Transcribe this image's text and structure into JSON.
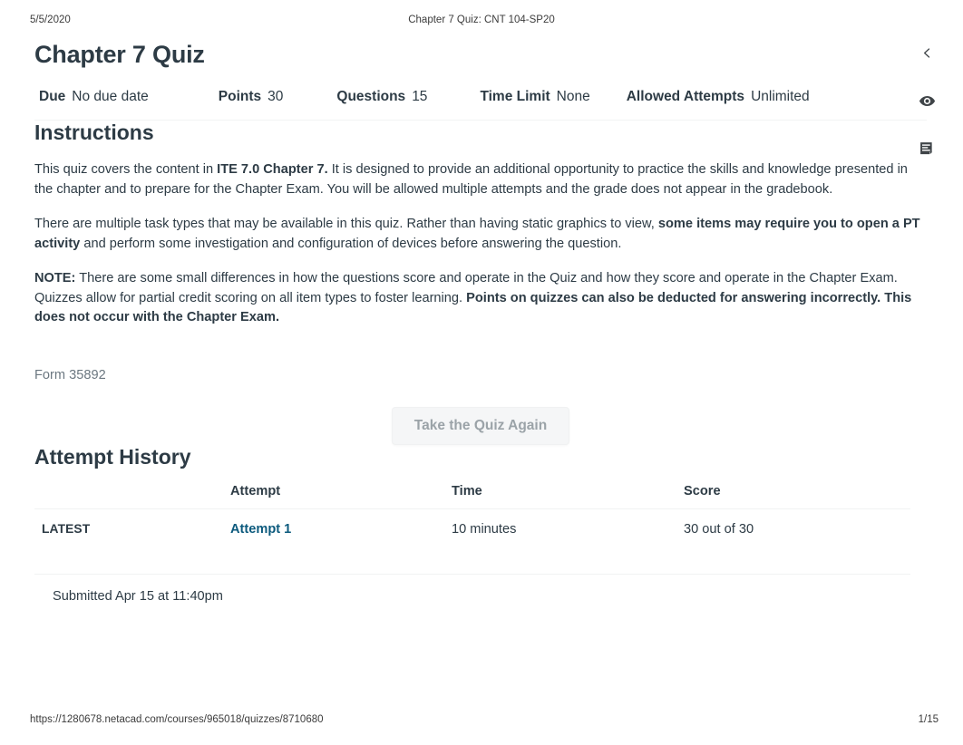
{
  "print_header": {
    "date": "5/5/2020",
    "title": "Chapter 7 Quiz: CNT 104-SP20"
  },
  "print_footer": {
    "url": "https://1280678.netacad.com/courses/965018/quizzes/8710680",
    "page": "1/15"
  },
  "right_rail": {
    "collapse_icon": "chevron-left-icon",
    "preview_icon": "eye-icon",
    "rubric_icon": "document-lines-icon"
  },
  "quiz": {
    "title": "Chapter 7 Quiz",
    "meta": [
      {
        "key": "Due",
        "value": "No due date"
      },
      {
        "key": "Points",
        "value": "30"
      },
      {
        "key": "Questions",
        "value": "15"
      },
      {
        "key": "Time Limit",
        "value": "None"
      },
      {
        "key": "Allowed Attempts",
        "value": "Unlimited"
      }
    ],
    "instructions_heading": "Instructions",
    "paragraphs": {
      "p1_a": "This quiz covers the content in ",
      "p1_b": "ITE 7.0 Chapter 7.",
      "p1_c": " It is designed to provide an additional opportunity to practice the skills and knowledge presented in the chapter and to prepare for the Chapter Exam. You will be allowed multiple attempts and the grade does not appear in the gradebook.",
      "p2_a": "There are multiple task types that may be available in this quiz. Rather than having static graphics to view, ",
      "p2_b": "some items may require you to open a PT activity",
      "p2_c": " and perform some investigation and configuration of devices before answering the question.",
      "p3_a": "NOTE:",
      "p3_b": " There are some small differences in how the questions score and operate in the Quiz and how they score and operate in the Chapter Exam. Quizzes allow for partial credit scoring on all item types to foster learning. ",
      "p3_c": "Points on quizzes can also be deducted for answering incorrectly. This does not occur with the Chapter Exam."
    },
    "form_id": "Form 35892",
    "take_again_label": "Take the Quiz Again"
  },
  "attempt_history": {
    "heading": "Attempt History",
    "columns": [
      "",
      "Attempt",
      "Time",
      "Score"
    ],
    "rows": [
      {
        "latest": "LATEST",
        "attempt": "Attempt 1",
        "time": "10 minutes",
        "score": "30 out of 30"
      }
    ],
    "submitted": "Submitted Apr 15 at 11:40pm"
  },
  "colors": {
    "link": "#0c5a7d",
    "text": "#2d3b45",
    "muted": "#6b7780",
    "button_bg": "#f5f6f7"
  }
}
